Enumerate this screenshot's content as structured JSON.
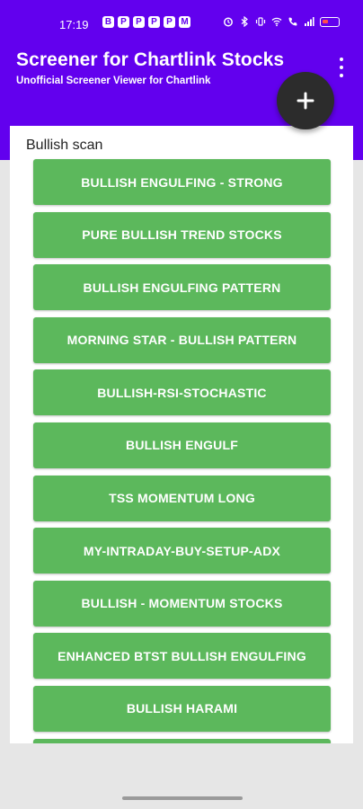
{
  "status_bar": {
    "time": "17:19",
    "notification_icons": [
      "B",
      "P",
      "P",
      "P",
      "P",
      "M"
    ],
    "battery_color": "#ff4d4d"
  },
  "app_bar": {
    "title": "Screener for Chartlink Stocks",
    "subtitle": "Unofficial Screener Viewer for Chartlink",
    "color": "#6200ee"
  },
  "fab": {
    "icon": "plus-icon"
  },
  "section": {
    "title": "Bullish scan",
    "button_color": "#5cb85c",
    "items": [
      {
        "label": "BULLISH ENGULFING - STRONG"
      },
      {
        "label": "PURE BULLISH TREND STOCKS"
      },
      {
        "label": "BULLISH ENGULFING PATTERN"
      },
      {
        "label": "MORNING STAR - BULLISH PATTERN"
      },
      {
        "label": "BULLISH-RSI-STOCHASTIC"
      },
      {
        "label": "BULLISH ENGULF"
      },
      {
        "label": "TSS MOMENTUM LONG"
      },
      {
        "label": "MY-INTRADAY-BUY-SETUP-ADX"
      },
      {
        "label": "BULLISH - MOMENTUM STOCKS"
      },
      {
        "label": "ENHANCED BTST BULLISH ENGULFING"
      },
      {
        "label": "BULLISH HARAMI"
      },
      {
        "label": ""
      }
    ]
  }
}
